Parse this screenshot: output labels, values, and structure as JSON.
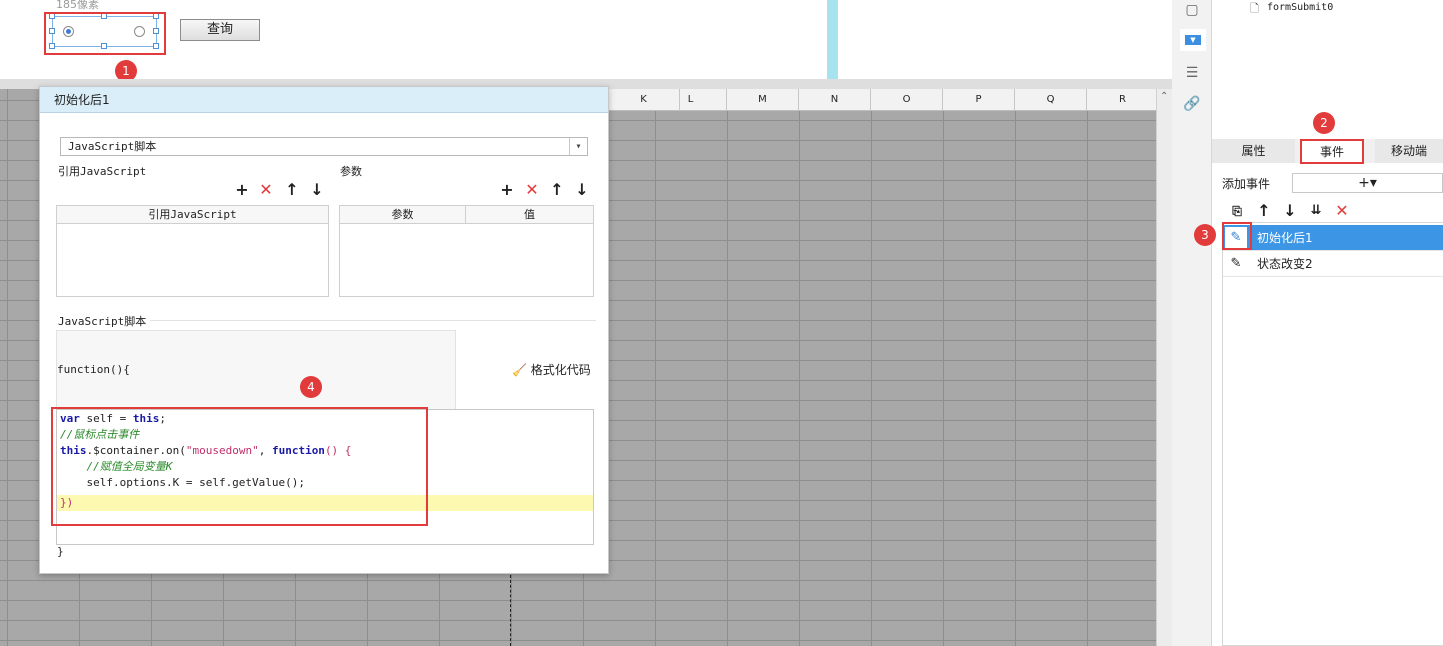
{
  "canvas": {
    "size_hint": "185像素",
    "query_button": "查询",
    "col_headers": [
      "K",
      "L",
      "M",
      "N",
      "O",
      "P",
      "Q",
      "R"
    ]
  },
  "badges": [
    "1",
    "2",
    "3",
    "4"
  ],
  "dialog": {
    "title": "初始化后1",
    "type_value": "JavaScript脚本",
    "ref_js_label": "引用JavaScript",
    "params_label": "参数",
    "ref_table_header": "引用JavaScript",
    "param_table_headers": [
      "参数",
      "值"
    ],
    "script_label": "JavaScript脚本",
    "func_open": "function(){",
    "func_close": "}",
    "format_btn": "格式化代码",
    "code": {
      "l1_kw1": "var",
      "l1_mid": " self = ",
      "l1_kw2": "this",
      "l1_end": ";",
      "l2": "//鼠标点击事件",
      "l3_kw1": "this",
      "l3_mid": ".$container.on(",
      "l3_str": "\"mousedown\"",
      "l3_mid2": ", ",
      "l3_kw2": "function",
      "l3_end": "() {",
      "l4": "    //赋值全局变量K",
      "l5": "    self.options.K = self.getValue();",
      "l6": "})"
    }
  },
  "tree": {
    "item": "formSubmit0"
  },
  "right_panel": {
    "tabs": [
      "属性",
      "事件",
      "移动端"
    ],
    "add_event_label": "添加事件",
    "add_event_btn": "+▾",
    "events": [
      "初始化后1",
      "状态改变2"
    ]
  },
  "colors": {
    "accent": "#3c96e5",
    "annotation": "#e23b3b",
    "dialog_title_bg": "#d9eef9"
  }
}
